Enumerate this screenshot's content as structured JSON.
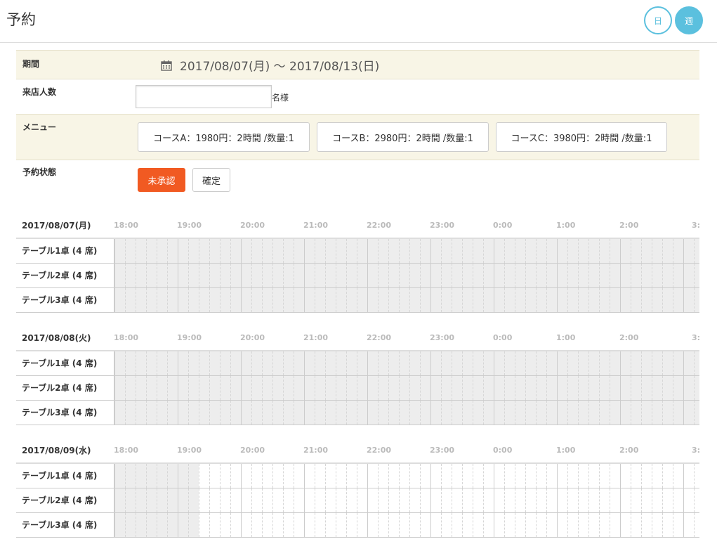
{
  "header": {
    "title": "予約",
    "view_day_label": "日",
    "view_week_label": "週"
  },
  "form": {
    "period": {
      "label": "期間",
      "value": "2017/08/07(月) ～ 2017/08/13(日)",
      "icon": "calendar-icon"
    },
    "people": {
      "label": "来店人数",
      "value": "",
      "placeholder": "",
      "unit": "名様"
    },
    "menu": {
      "label": "メニュー",
      "courses": [
        "コースA：1980円：2時間 /数量:1",
        "コースB：2980円：2時間 /数量:1",
        "コースC：3980円：2時間 /数量:1"
      ]
    },
    "status": {
      "label": "予約状態",
      "unapproved": "未承認",
      "confirmed": "確定"
    }
  },
  "schedule": {
    "time_labels": [
      "18:00",
      "19:00",
      "20:00",
      "21:00",
      "22:00",
      "23:00",
      "0:00",
      "1:00",
      "2:00",
      "3:"
    ],
    "days": [
      {
        "date": "2017/08/07(月)",
        "unavailable_hours": 9.25,
        "tables": [
          "テーブル1卓 (4 席)",
          "テーブル2卓 (4 席)",
          "テーブル3卓 (4 席)"
        ]
      },
      {
        "date": "2017/08/08(火)",
        "unavailable_hours": 9.25,
        "tables": [
          "テーブル1卓 (4 席)",
          "テーブル2卓 (4 席)",
          "テーブル3卓 (4 席)"
        ]
      },
      {
        "date": "2017/08/09(水)",
        "unavailable_hours": 1.33,
        "tables": [
          "テーブル1卓 (4 席)",
          "テーブル2卓 (4 席)",
          "テーブル3卓 (4 席)"
        ]
      }
    ]
  },
  "colors": {
    "accent": "#5bc0de",
    "unapproved": "#f15a22",
    "form_band": "#f8f5e6",
    "unavailable": "#ededed"
  }
}
